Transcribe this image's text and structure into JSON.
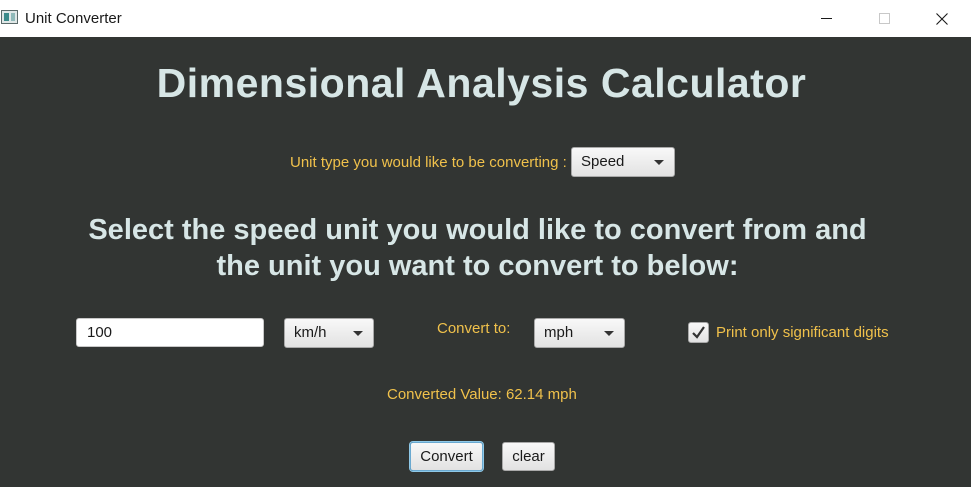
{
  "window": {
    "title": "Unit Converter",
    "icons": {
      "app": "app-window-icon",
      "minimize": "minimize-icon",
      "maximize": "maximize-icon",
      "close": "close-icon"
    }
  },
  "header": {
    "title": "Dimensional Analysis Calculator"
  },
  "unit_type": {
    "label": "Unit type you would like to be converting :",
    "selected": "Speed"
  },
  "instruction": {
    "line1": "Select the speed unit you would like to convert from and",
    "line2": "the unit you want to convert to below:"
  },
  "conversion": {
    "input_value": "100",
    "from_unit": "km/h",
    "convert_to_label": "Convert to:",
    "to_unit": "mph",
    "sig_digits_checked": true,
    "sig_digits_label": "Print only significant digits",
    "result": "Converted Value: 62.14 mph"
  },
  "buttons": {
    "convert": "Convert",
    "clear": "clear"
  },
  "colors": {
    "background": "#323533",
    "title_text": "#d7e6e6",
    "label_text": "#f0c14b"
  }
}
